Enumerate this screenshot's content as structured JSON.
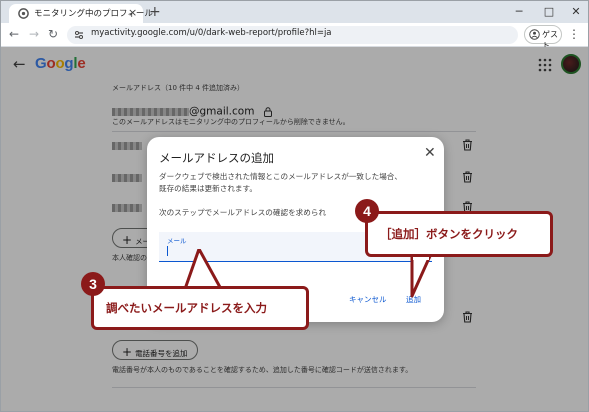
{
  "browser": {
    "tab_title": "モニタリング中のプロフィール",
    "new_tab": "+",
    "url": "myactivity.google.com/u/0/dark-web-report/profile?hl=ja",
    "guest_label": "ゲスト",
    "window_controls": {
      "minimize": "─",
      "maximize": "□",
      "close": "✕"
    },
    "menu": "⋮"
  },
  "page": {
    "back": "←",
    "logo_letters": [
      {
        "ch": "G",
        "color": "#4285F4"
      },
      {
        "ch": "o",
        "color": "#EA4335"
      },
      {
        "ch": "o",
        "color": "#FBBC05"
      },
      {
        "ch": "g",
        "color": "#4285F4"
      },
      {
        "ch": "l",
        "color": "#34A853"
      },
      {
        "ch": "e",
        "color": "#EA4335"
      }
    ],
    "section_label": "メールアドレス（10 件中 4 件追加済み）",
    "primary_email_suffix": "@gmail.com",
    "primary_note": "このメールアドレスはモニタリング中のプロフィールから削除できません。",
    "add_email_button": "メー",
    "below_add_note": "本人確認の",
    "add_phone_button": "電話番号を追加",
    "phone_note": "電話番号が本人のものであることを確認するため、追加した番号に確認コードが送信されます。"
  },
  "dialog": {
    "title": "メールアドレスの追加",
    "close": "✕",
    "line1": "ダークウェブで検出された情報とこのメールアドレスが一致した場合、",
    "line2": "既存の結果は更新されます。",
    "line3": "次のステップでメールアドレスの確認を求められ",
    "field_label": "メール",
    "field_value": "",
    "cancel": "キャンセル",
    "add": "追加"
  },
  "callouts": {
    "step3_number": "3",
    "step3_text": "調べたいメールアドレスを入力",
    "step4_number": "4",
    "step4_text": "［追加］ボタンをクリック"
  },
  "colors": {
    "callout": "#8b1a1a",
    "accent": "#0b57d0"
  }
}
